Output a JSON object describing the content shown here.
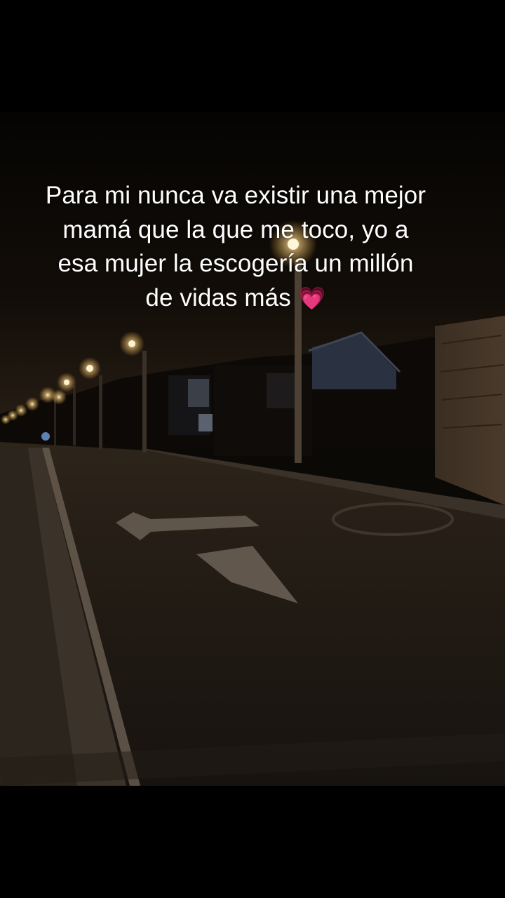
{
  "video": {
    "scene_icon": "night-street-scene",
    "caption_text": "Para mi nunca va existir una mejor mamá que la que me toco, yo a esa mujer la escogería un millón de vidas más",
    "caption_emoji": "💗",
    "colors": {
      "background": "#000000",
      "caption": "#ffffff",
      "heart": "#ff6fa8",
      "streetlight": "#ffd98a"
    }
  }
}
